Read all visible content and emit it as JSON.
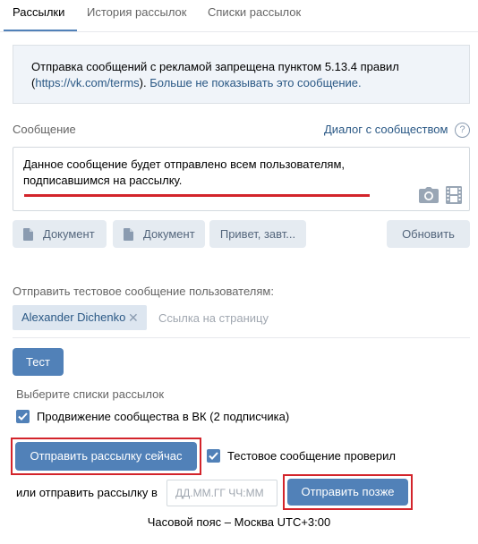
{
  "tabs": [
    {
      "label": "Рассылки"
    },
    {
      "label": "История рассылок"
    },
    {
      "label": "Списки рассылок"
    }
  ],
  "notice": {
    "line1": "Отправка сообщений с рекламой запрещена пунктом 5.13.4 правил",
    "open_paren": "(",
    "link_terms": "https://vk.com/terms",
    "close_paren": ").",
    "link_hide": "Больше не показывать это сообщение."
  },
  "message": {
    "label": "Сообщение",
    "dialog_link": "Диалог с сообществом",
    "help_glyph": "?",
    "text": "Данное сообщение будет отправлено всем пользователям, подписавшимся на рассылку."
  },
  "attachments": {
    "doc1": "Документ",
    "doc2": "Документ",
    "greeting": "Привет, завт...",
    "refresh": "Обновить"
  },
  "test": {
    "label": "Отправить тестовое сообщение пользователям:",
    "user_chip": "Alexander Dichenko",
    "remove_glyph": "✕",
    "page_placeholder": "Ссылка на страницу",
    "button": "Тест"
  },
  "lists": {
    "label": "Выберите списки рассылок",
    "item": "Продвижение сообщества в ВК (2 подписчика)",
    "item_checked": true
  },
  "send": {
    "now_button": "Отправить рассылку сейчас",
    "test_checked_label": "Тестовое сообщение проверил",
    "or_label": "или отправить рассылку в",
    "date_placeholder": "ДД.ММ.ГГ ЧЧ:ММ",
    "later_button": "Отправить позже",
    "timezone": "Часовой пояс – Москва UTC+3:00"
  },
  "colors": {
    "accent": "#5181b8",
    "link": "#2a5885",
    "highlight_red": "#d3242b",
    "notice_bg": "#f0f4f9",
    "grey_button": "#e5ebf1"
  },
  "icons": [
    "document-icon",
    "camera-icon",
    "video-icon",
    "help-icon",
    "checkmark-icon",
    "close-icon"
  ]
}
